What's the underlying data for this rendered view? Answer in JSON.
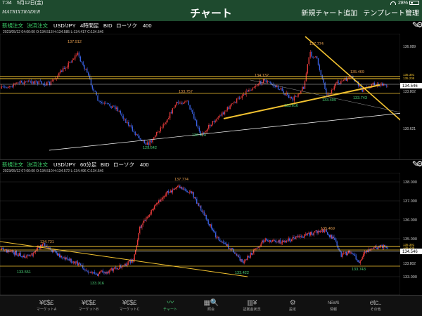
{
  "status": {
    "time": "7:34",
    "date": "5月12日(金)",
    "battery": "28%"
  },
  "nav": {
    "logo": "MATRIXTRADER",
    "title": "チャート",
    "add_chart": "新規チャート追加",
    "template": "テンプレート管理"
  },
  "panels": [
    {
      "new_order": "新規注文",
      "settle_order": "決済注文",
      "pair": "USD/JPY",
      "timeframe": "4時間足",
      "side": "BID",
      "chart_style": "ローソク",
      "count": "400",
      "info": "2023/05/12 04:00:00  O:134.513  H:134.585  L:134.417  C:134.546",
      "price_labels": [
        "136.089",
        "135.391",
        "135.205",
        "134.546",
        "133.802",
        "130.621"
      ],
      "annotations": [
        "137.912",
        "134.132",
        "133.757",
        "133.616",
        "133.409",
        "133.743",
        "130.614",
        "129.642",
        "137.774",
        "135.469"
      ]
    },
    {
      "new_order": "新規注文",
      "settle_order": "決済注文",
      "pair": "USD/JPY",
      "timeframe": "60分足",
      "side": "BID",
      "chart_style": "ローソク",
      "count": "400",
      "info": "2023/05/12 07:00:00  O:134.510  H:134.572  L:134.496  C:134.546",
      "price_labels": [
        "138.000",
        "137.000",
        "136.000",
        "135.000",
        "134.546",
        "133.802",
        "133.000",
        "135.391",
        "135.205"
      ],
      "annotations": [
        "137.774",
        "134.731",
        "133.551",
        "133.016",
        "135.469",
        "133.422",
        "133.743"
      ]
    }
  ],
  "tabs": [
    {
      "icon": "¥€$£",
      "label": "マーケットA"
    },
    {
      "icon": "¥€$£",
      "label": "マーケットB"
    },
    {
      "icon": "¥€$£",
      "label": "マーケットC"
    },
    {
      "icon": "〰",
      "label": "チャート"
    },
    {
      "icon": "▦🔍",
      "label": "照会"
    },
    {
      "icon": "▥¥",
      "label": "証拠金状況"
    },
    {
      "icon": "⚙",
      "label": "設定"
    },
    {
      "icon": "NEWS",
      "label": "情報"
    },
    {
      "icon": "etc..",
      "label": "その他"
    }
  ],
  "colors": {
    "bull": "#e33a3a",
    "bear": "#3a62e3",
    "line": "#f2c230",
    "accent": "#4dd47a"
  }
}
